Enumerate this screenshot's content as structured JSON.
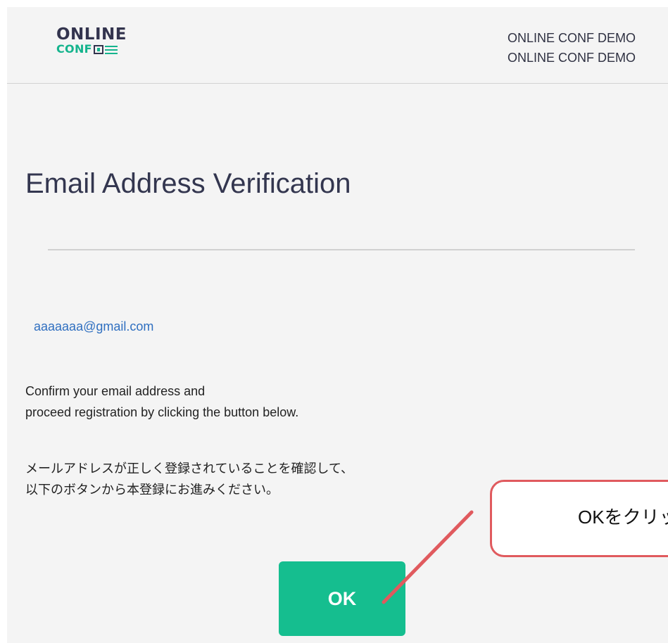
{
  "header": {
    "logo": {
      "line1": "ONLINE",
      "line2": "CONF"
    },
    "right_line1": "ONLINE CONF DEMO",
    "right_line2": "ONLINE CONF DEMO"
  },
  "main": {
    "title": "Email Address Verification",
    "email": "aaaaaaa@gmail.com",
    "message_en_line1": "Confirm your email address and",
    "message_en_line2": "proceed registration by clicking the button below.",
    "message_ja_line1": "メールアドレスが正しく登録されていることを確認して、",
    "message_ja_line2": "以下のボタンから本登録にお進みください。",
    "ok_button": "OK"
  },
  "annotation": {
    "callout_text": "OKをクリッ",
    "color": "#e05a5e"
  },
  "colors": {
    "accent": "#15be8f",
    "navy": "#33344e",
    "link": "#2f6fc0"
  }
}
